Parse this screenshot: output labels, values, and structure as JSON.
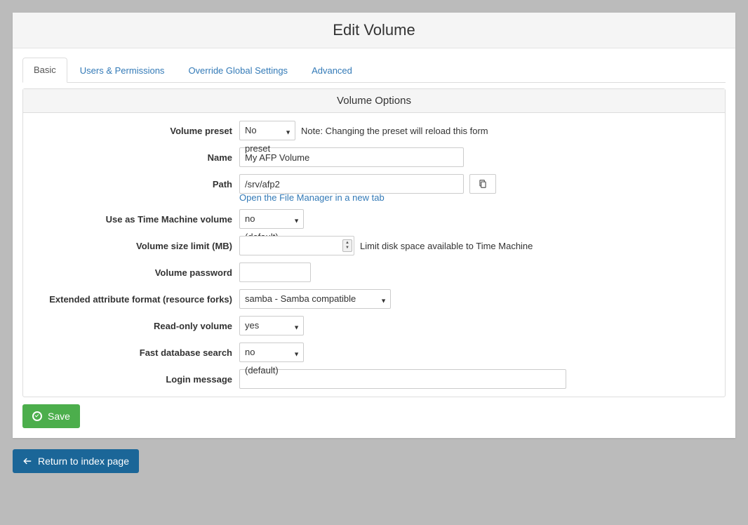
{
  "header": {
    "title": "Edit Volume"
  },
  "tabs": [
    {
      "label": "Basic",
      "active": true
    },
    {
      "label": "Users & Permissions",
      "active": false
    },
    {
      "label": "Override Global Settings",
      "active": false
    },
    {
      "label": "Advanced",
      "active": false
    }
  ],
  "options_title": "Volume Options",
  "form": {
    "preset": {
      "label": "Volume preset",
      "value": "No preset",
      "note": "Note: Changing the preset will reload this form"
    },
    "name": {
      "label": "Name",
      "value": "My AFP Volume"
    },
    "path": {
      "label": "Path",
      "value": "/srv/afp2",
      "browse_icon": "file-browse-icon",
      "link_text": "Open the File Manager in a new tab"
    },
    "time_machine": {
      "label": "Use as Time Machine volume",
      "value": "no (default)"
    },
    "size_limit": {
      "label": "Volume size limit (MB)",
      "value": "",
      "note": "Limit disk space available to Time Machine"
    },
    "password": {
      "label": "Volume password",
      "value": ""
    },
    "ea_format": {
      "label": "Extended attribute format (resource forks)",
      "value": "samba - Samba compatible"
    },
    "readonly": {
      "label": "Read-only volume",
      "value": "yes"
    },
    "fast_db": {
      "label": "Fast database search",
      "value": "no (default)"
    },
    "login_msg": {
      "label": "Login message",
      "value": ""
    }
  },
  "buttons": {
    "save": "Save",
    "return": "Return to index page"
  }
}
